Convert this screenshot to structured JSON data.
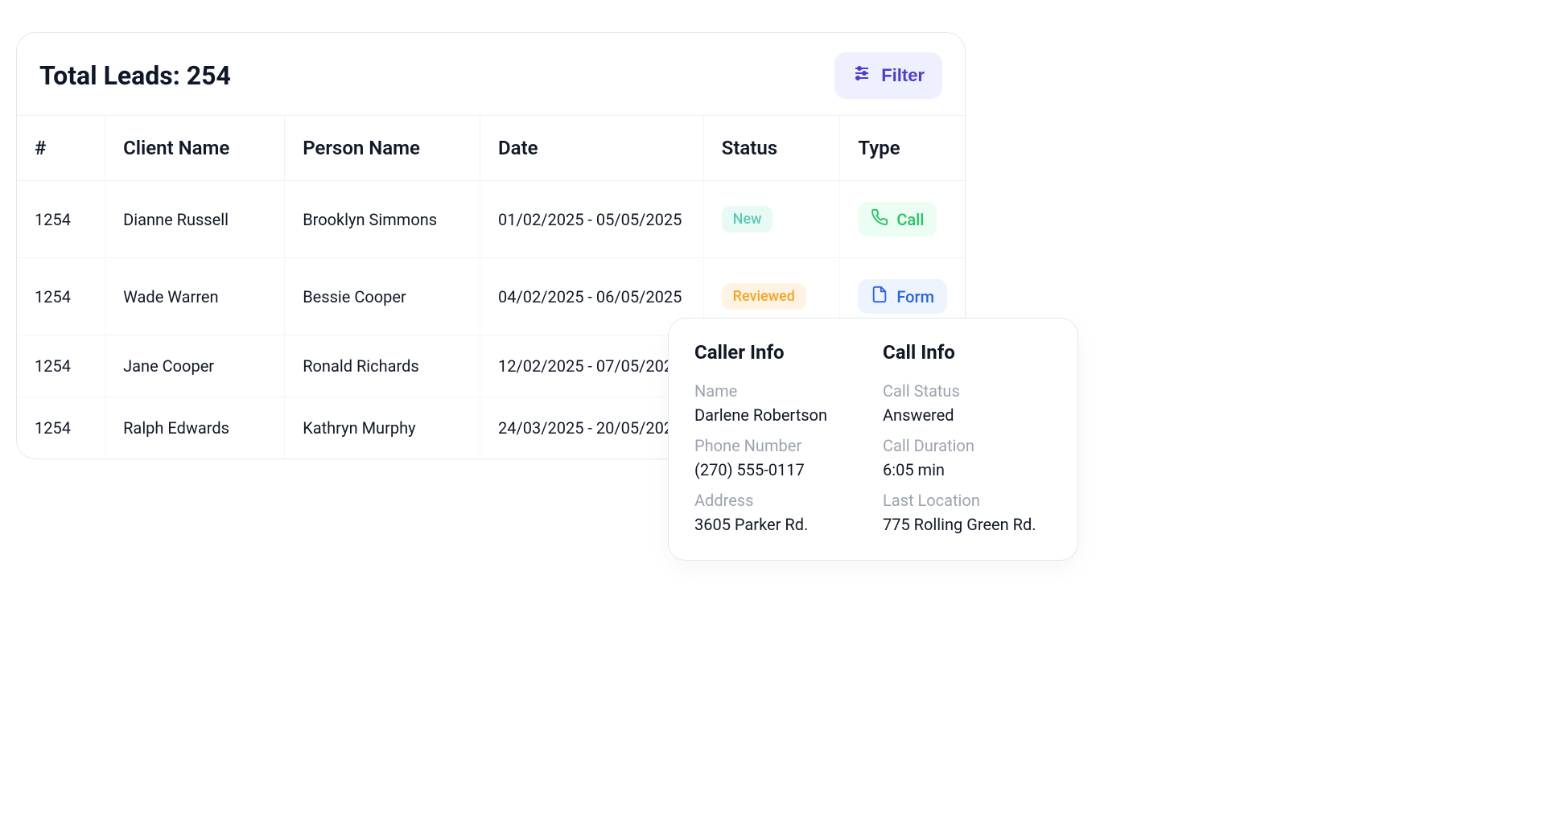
{
  "header": {
    "title_prefix": "Total Leads: ",
    "total_leads": "254",
    "filter_label": "Filter"
  },
  "table": {
    "columns": {
      "idx": "#",
      "client": "Client Name",
      "person": "Person Name",
      "date": "Date",
      "status": "Status",
      "type": "Type"
    },
    "rows": [
      {
        "idx": "1254",
        "client": "Dianne Russell",
        "person": "Brooklyn Simmons",
        "date": "01/02/2025 - 05/05/2025",
        "status": {
          "label": "New",
          "variant": "new"
        },
        "type": {
          "label": "Call",
          "variant": "call"
        }
      },
      {
        "idx": "1254",
        "client": "Wade Warren",
        "person": "Bessie Cooper",
        "date": "04/02/2025 - 06/05/2025",
        "status": {
          "label": "Reviewed",
          "variant": "reviewed"
        },
        "type": {
          "label": "Form",
          "variant": "form"
        }
      },
      {
        "idx": "1254",
        "client": "Jane Cooper",
        "person": "Ronald Richards",
        "date": "12/02/2025 - 07/05/202",
        "status": null,
        "type": null
      },
      {
        "idx": "1254",
        "client": "Ralph Edwards",
        "person": "Kathryn Murphy",
        "date": "24/03/2025 - 20/05/202",
        "status": null,
        "type": null
      }
    ]
  },
  "popover": {
    "caller": {
      "title": "Caller Info",
      "fields": [
        {
          "label": "Name",
          "value": "Darlene Robertson"
        },
        {
          "label": "Phone Number",
          "value": "(270) 555-0117"
        },
        {
          "label": "Address",
          "value": "3605 Parker Rd."
        }
      ]
    },
    "call": {
      "title": "Call Info",
      "fields": [
        {
          "label": "Call Status",
          "value": "Answered"
        },
        {
          "label": "Call Duration",
          "value": "6:05 min"
        },
        {
          "label": "Last Location",
          "value": "775 Rolling Green Rd."
        }
      ]
    }
  }
}
